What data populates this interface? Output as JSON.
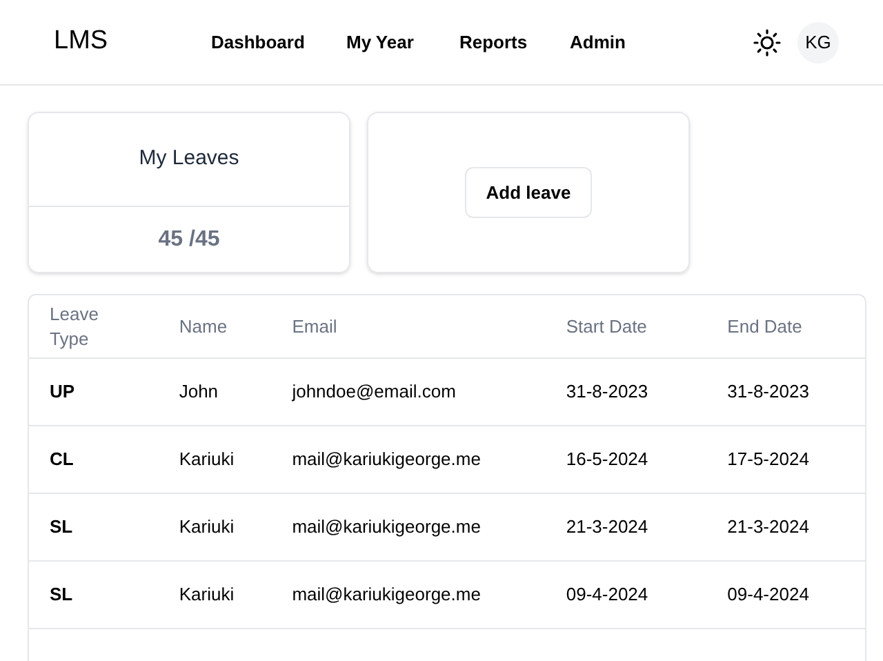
{
  "header": {
    "logo": "LMS",
    "nav": [
      {
        "label": "Dashboard"
      },
      {
        "label": "My Year"
      },
      {
        "label": "Reports"
      },
      {
        "label": "Admin"
      }
    ],
    "avatar": "KG"
  },
  "leaves_card": {
    "title": "My Leaves",
    "count": "45 /45"
  },
  "add_button": "Add leave",
  "table": {
    "columns": [
      "Leave Type",
      "Name",
      "Email",
      "Start Date",
      "End Date"
    ],
    "rows": [
      [
        "UP",
        "John",
        "johndoe@email.com",
        "31-8-2023",
        "31-8-2023"
      ],
      [
        "CL",
        "Kariuki",
        "mail@kariukigeorge.me",
        "16-5-2024",
        "17-5-2024"
      ],
      [
        "SL",
        "Kariuki",
        "mail@kariukigeorge.me",
        "21-3-2024",
        "21-3-2024"
      ],
      [
        "SL",
        "Kariuki",
        "mail@kariukigeorge.me",
        "09-4-2024",
        "09-4-2024"
      ]
    ]
  }
}
